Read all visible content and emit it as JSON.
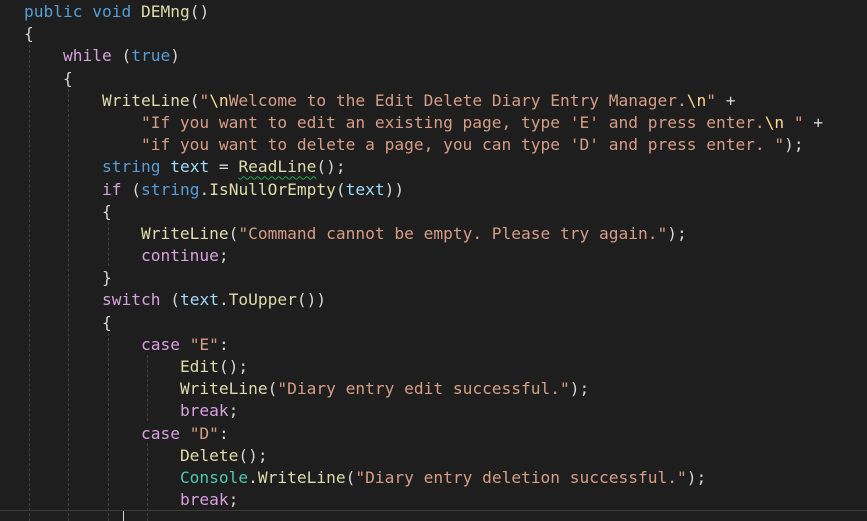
{
  "colors": {
    "background": "#1e1e1e",
    "default_text": "#d4d4d4",
    "keyword": "#569cd6",
    "control_keyword": "#d8a0df",
    "method": "#dcdcaa",
    "string": "#d69d85",
    "escape": "#ffd68f",
    "type": "#4ec9b0",
    "variable": "#9cdcfe",
    "squiggle": "#1ea650",
    "indent_guide": "#404040"
  },
  "code_lines": [
    [
      {
        "t": "public",
        "k": "keyword"
      },
      {
        "t": " "
      },
      {
        "t": "void",
        "k": "keyword"
      },
      {
        "t": " "
      },
      {
        "t": "DEMng",
        "k": "method"
      },
      {
        "t": "()"
      }
    ],
    [
      {
        "t": "{"
      }
    ],
    [
      {
        "t": "    "
      },
      {
        "t": "while",
        "k": "control"
      },
      {
        "t": " ("
      },
      {
        "t": "true",
        "k": "keyword"
      },
      {
        "t": ")"
      }
    ],
    [
      {
        "t": "    {"
      }
    ],
    [
      {
        "t": "        "
      },
      {
        "t": "WriteLine",
        "k": "method"
      },
      {
        "t": "("
      },
      {
        "t": "\"",
        "k": "string"
      },
      {
        "t": "\\n",
        "k": "escape"
      },
      {
        "t": "Welcome to the Edit Delete Diary Entry Manager.",
        "k": "string"
      },
      {
        "t": "\\n",
        "k": "escape"
      },
      {
        "t": "\"",
        "k": "string"
      },
      {
        "t": " +"
      }
    ],
    [
      {
        "t": "            "
      },
      {
        "t": "\"If you want to edit an existing page, type 'E' and press enter.",
        "k": "string"
      },
      {
        "t": "\\n",
        "k": "escape"
      },
      {
        "t": " \"",
        "k": "string"
      },
      {
        "t": " +"
      }
    ],
    [
      {
        "t": "            "
      },
      {
        "t": "\"if you want to delete a page, you can type 'D' and press enter. \"",
        "k": "string"
      },
      {
        "t": ");"
      }
    ],
    [
      {
        "t": "        "
      },
      {
        "t": "string",
        "k": "keyword"
      },
      {
        "t": " "
      },
      {
        "t": "text",
        "k": "variable"
      },
      {
        "t": " = "
      },
      {
        "t": "ReadLine",
        "k": "method",
        "squiggle": true
      },
      {
        "t": "();"
      }
    ],
    [
      {
        "t": "        "
      },
      {
        "t": "if",
        "k": "control"
      },
      {
        "t": " ("
      },
      {
        "t": "string",
        "k": "keyword"
      },
      {
        "t": "."
      },
      {
        "t": "IsNullOrEmpty",
        "k": "method"
      },
      {
        "t": "("
      },
      {
        "t": "text",
        "k": "variable"
      },
      {
        "t": "))"
      }
    ],
    [
      {
        "t": "        {"
      }
    ],
    [
      {
        "t": "            "
      },
      {
        "t": "WriteLine",
        "k": "method"
      },
      {
        "t": "("
      },
      {
        "t": "\"Command cannot be empty. Please try again.\"",
        "k": "string"
      },
      {
        "t": ");"
      }
    ],
    [
      {
        "t": "            "
      },
      {
        "t": "continue",
        "k": "control"
      },
      {
        "t": ";"
      }
    ],
    [
      {
        "t": "        }"
      }
    ],
    [
      {
        "t": "        "
      },
      {
        "t": "switch",
        "k": "control"
      },
      {
        "t": " ("
      },
      {
        "t": "text",
        "k": "variable"
      },
      {
        "t": "."
      },
      {
        "t": "ToUpper",
        "k": "method"
      },
      {
        "t": "())"
      }
    ],
    [
      {
        "t": "        {"
      }
    ],
    [
      {
        "t": "            "
      },
      {
        "t": "case",
        "k": "control"
      },
      {
        "t": " "
      },
      {
        "t": "\"E\"",
        "k": "string"
      },
      {
        "t": ":"
      }
    ],
    [
      {
        "t": "                "
      },
      {
        "t": "Edit",
        "k": "method"
      },
      {
        "t": "();"
      }
    ],
    [
      {
        "t": "                "
      },
      {
        "t": "WriteLine",
        "k": "method"
      },
      {
        "t": "("
      },
      {
        "t": "\"Diary entry edit successful.\"",
        "k": "string"
      },
      {
        "t": ");"
      }
    ],
    [
      {
        "t": "                "
      },
      {
        "t": "break",
        "k": "control"
      },
      {
        "t": ";"
      }
    ],
    [
      {
        "t": "            "
      },
      {
        "t": "case",
        "k": "control"
      },
      {
        "t": " "
      },
      {
        "t": "\"D\"",
        "k": "string"
      },
      {
        "t": ":"
      }
    ],
    [
      {
        "t": "                "
      },
      {
        "t": "Delete",
        "k": "method"
      },
      {
        "t": "();"
      }
    ],
    [
      {
        "t": "                "
      },
      {
        "t": "Console",
        "k": "type"
      },
      {
        "t": "."
      },
      {
        "t": "WriteLine",
        "k": "method"
      },
      {
        "t": "("
      },
      {
        "t": "\"Diary entry deletion successful.\"",
        "k": "string"
      },
      {
        "t": ");"
      }
    ],
    [
      {
        "t": "                "
      },
      {
        "t": "break",
        "k": "control"
      },
      {
        "t": ";"
      }
    ]
  ]
}
